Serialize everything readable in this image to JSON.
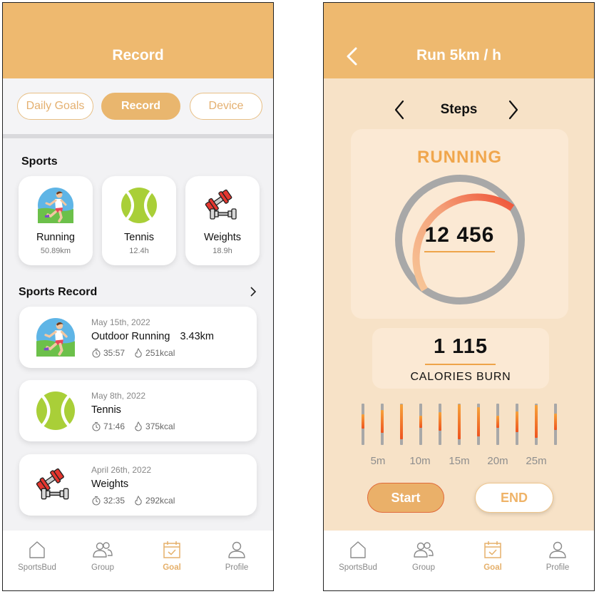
{
  "left_screen": {
    "title": "Record",
    "tabs": [
      {
        "label": "Daily Goals",
        "active": false
      },
      {
        "label": "Record",
        "active": true
      },
      {
        "label": "Device",
        "active": false
      }
    ],
    "sports_title": "Sports",
    "sports": [
      {
        "name": "Running",
        "value": "50.89km",
        "icon": "runner-icon"
      },
      {
        "name": "Tennis",
        "value": "12.4h",
        "icon": "tennis-ball-icon"
      },
      {
        "name": "Weights",
        "value": "18.9h",
        "icon": "dumbbell-icon"
      }
    ],
    "record_title": "Sports Record",
    "records": [
      {
        "date": "May 15th, 2022",
        "title": "Outdoor Running",
        "distance": "3.43km",
        "time": "35:57",
        "calories": "251kcal",
        "icon": "runner-icon"
      },
      {
        "date": "May 8th, 2022",
        "title": "Tennis",
        "distance": "",
        "time": "71:46",
        "calories": "375kcal",
        "icon": "tennis-ball-icon"
      },
      {
        "date": "April 26th, 2022",
        "title": "Weights",
        "distance": "",
        "time": "32:35",
        "calories": "292kcal",
        "icon": "dumbbell-icon"
      }
    ]
  },
  "right_screen": {
    "title": "Run 5km / h",
    "metric_label": "Steps",
    "activity": "RUNNING",
    "steps": "12 456",
    "calories_value": "1 115",
    "calories_label": "CALORIES BURN",
    "timeline_bars": [
      0.35,
      0.55,
      0.85,
      0.3,
      0.45,
      0.85,
      0.7,
      0.3,
      0.5,
      0.8,
      0.4
    ],
    "timeline_labels": [
      "5m",
      "10m",
      "15m",
      "20m",
      "25m"
    ],
    "start_label": "Start",
    "end_label": "END"
  },
  "nav": [
    {
      "label": "SportsBud",
      "icon": "home-icon",
      "active": false
    },
    {
      "label": "Group",
      "icon": "group-icon",
      "active": false
    },
    {
      "label": "Goal",
      "icon": "calendar-check-icon",
      "active": true
    },
    {
      "label": "Profile",
      "icon": "profile-icon",
      "active": false
    }
  ],
  "colors": {
    "header": "#eeb96f",
    "accent_orange": "#f0a64c",
    "ring_red": "#ef5a3a",
    "right_bg": "#f7e2c7"
  }
}
